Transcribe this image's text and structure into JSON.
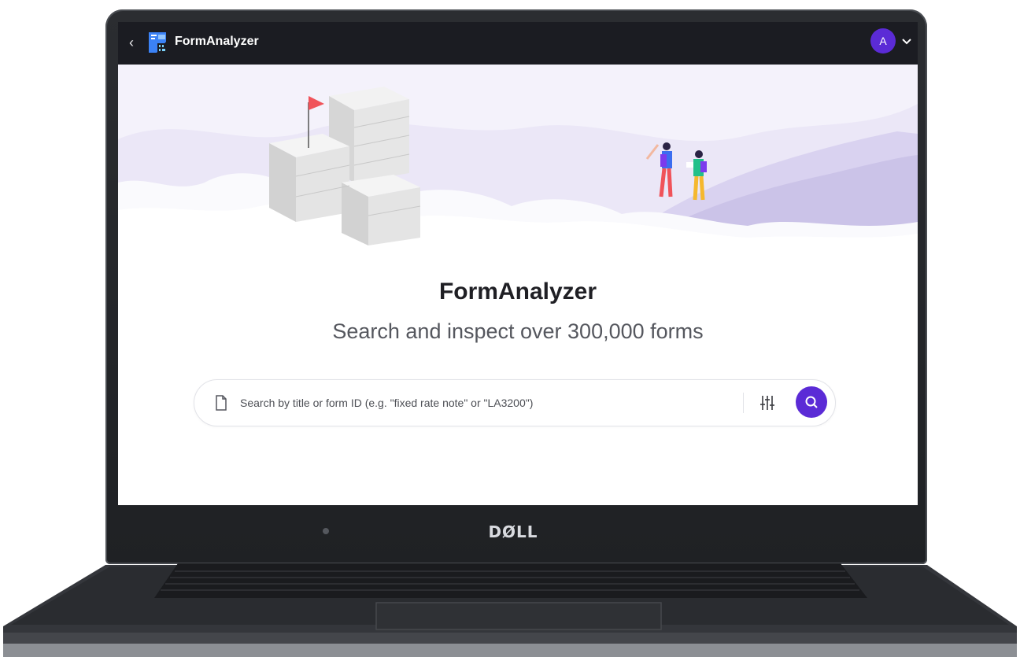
{
  "app": {
    "name": "FormAnalyzer",
    "back_label": "‹"
  },
  "user": {
    "avatar_initial": "A"
  },
  "hero": {
    "title": "FormAnalyzer",
    "subtitle": "Search and inspect over 300,000 forms"
  },
  "search": {
    "placeholder": "Search by title or form ID (e.g. \"fixed rate note\" or \"LA3200\")",
    "value": ""
  },
  "device": {
    "brand": "DØLL"
  },
  "icons": {
    "back": "chevron-left-icon",
    "logo": "form-logo-icon",
    "account_menu": "chevron-down-icon",
    "document": "file-icon",
    "filters": "sliders-icon",
    "search": "search-icon"
  },
  "colors": {
    "accent": "#5b2bd6",
    "topbar": "#1b1c22",
    "flag": "#f0535a",
    "cloud_tint": "#e8e4f6"
  }
}
